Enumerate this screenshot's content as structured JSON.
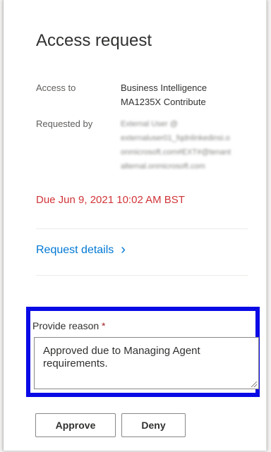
{
  "panel": {
    "title": "Access request",
    "fields": {
      "access_to_label": "Access to",
      "access_to_value_line1": "Business Intelligence",
      "access_to_value_line2": "MA1235X Contribute",
      "requested_by_label": "Requested by",
      "requested_by_value_blurred": "External User @\nexternaluser01_fqdnlinkedinsi.o\nonmicrosoft.com#EXT#@tenant\nalternal.onmicrosoft.com"
    },
    "due": "Due Jun 9, 2021 10:02 AM BST",
    "request_details_link": "Request details",
    "chevron_glyph": "›",
    "reason": {
      "label": "Provide reason",
      "required_mark": " *",
      "value": "Approved due to Managing Agent requirements."
    },
    "buttons": {
      "approve": "Approve",
      "deny": "Deny"
    }
  },
  "colors": {
    "due_text": "#d13438",
    "link": "#0078d4",
    "highlight_border": "#0a0ae6"
  }
}
